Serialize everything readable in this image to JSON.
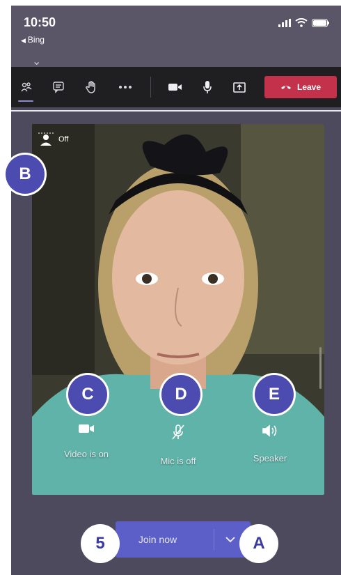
{
  "status_bar": {
    "time": "10:50",
    "back_app": "Bing"
  },
  "toolbar": {
    "buttons": [
      "people-icon",
      "chat-icon",
      "raise-hand-icon",
      "more-icon",
      "video-icon",
      "mic-icon",
      "share-icon"
    ],
    "leave_label": "Leave",
    "leave_color": "#c4314b"
  },
  "preview": {
    "background_blur_label": "Off",
    "controls": [
      {
        "label": "Video is on",
        "icon": "camera-icon"
      },
      {
        "label": "Mic is off",
        "icon": "mic-off-icon"
      },
      {
        "label": "Speaker",
        "icon": "speaker-icon"
      }
    ]
  },
  "join": {
    "label": "Join now",
    "accent": "#5b5fc7"
  },
  "callouts": {
    "a": "A",
    "b": "B",
    "c": "C",
    "d": "D",
    "e": "E",
    "five": "5"
  }
}
